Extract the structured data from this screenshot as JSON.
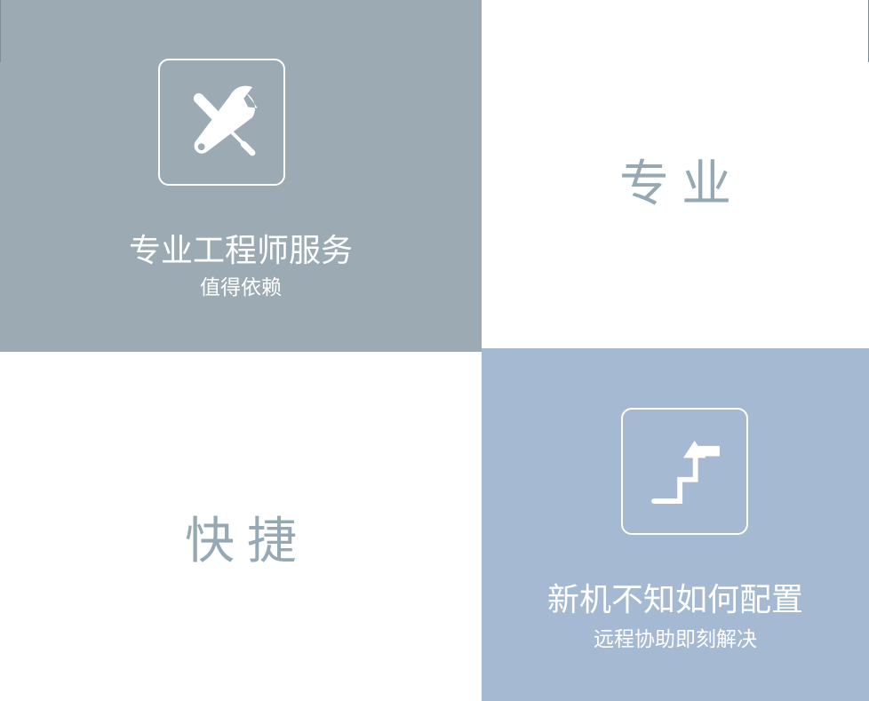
{
  "tiles": {
    "engineer": {
      "title": "专业工程师服务",
      "subtitle": "值得依赖",
      "icon": "wrench-screwdriver-icon",
      "bg": "#9cabb3"
    },
    "professional": {
      "word": "专业",
      "color": "#96a8b4"
    },
    "fast": {
      "word": "快捷",
      "color": "#96a8b4"
    },
    "remote": {
      "title": "新机不知如何配置",
      "subtitle": "远程协助即刻解决",
      "icon": "stairs-arrow-up-icon",
      "bg": "#a5b9d3"
    }
  }
}
